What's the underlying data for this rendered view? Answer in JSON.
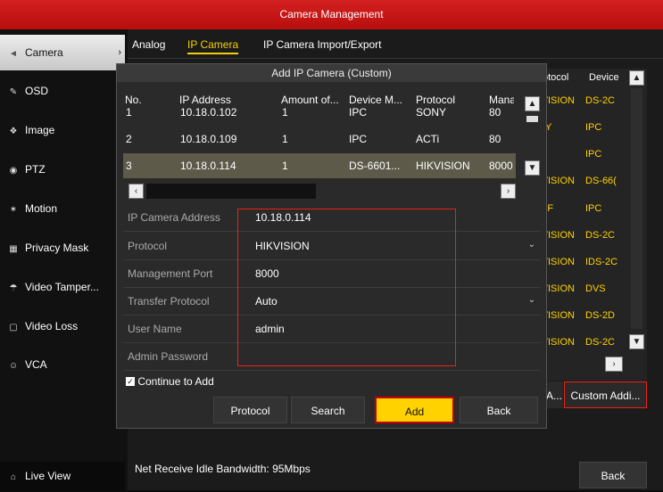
{
  "titlebar": {
    "title": "Camera Management"
  },
  "sidebar": {
    "items": [
      {
        "label": "Camera",
        "icon": "camera-icon",
        "glyph": "◄"
      },
      {
        "label": "OSD",
        "icon": "osd-icon",
        "glyph": "✎"
      },
      {
        "label": "Image",
        "icon": "image-icon",
        "glyph": "❖"
      },
      {
        "label": "PTZ",
        "icon": "ptz-icon",
        "glyph": "◉"
      },
      {
        "label": "Motion",
        "icon": "motion-icon",
        "glyph": "✶"
      },
      {
        "label": "Privacy Mask",
        "icon": "privacy-mask-icon",
        "glyph": "▦"
      },
      {
        "label": "Video Tamper...",
        "icon": "video-tamper-icon",
        "glyph": "☂"
      },
      {
        "label": "Video Loss",
        "icon": "video-loss-icon",
        "glyph": "▢"
      },
      {
        "label": "VCA",
        "icon": "vca-icon",
        "glyph": "☺"
      }
    ],
    "live_view": "Live View"
  },
  "tabs": [
    "Analog",
    "IP Camera",
    "IP Camera Import/Export"
  ],
  "bg_table": {
    "headers": [
      "otocol",
      "Device"
    ],
    "rows": [
      [
        "(VISION",
        "DS-2C"
      ],
      [
        "NY",
        "IPC"
      ],
      [
        "TI",
        "IPC"
      ],
      [
        "(VISION",
        "DS-66("
      ],
      [
        "VIF",
        "IPC"
      ],
      [
        "(VISION",
        "DS-2C"
      ],
      [
        "(VISION",
        "IDS-2C"
      ],
      [
        "(VISION",
        "DVS"
      ],
      [
        "(VISION",
        "DS-2D"
      ],
      [
        "(VISION",
        "DS-2C"
      ]
    ]
  },
  "dialog": {
    "title": "Add IP Camera (Custom)",
    "headers": [
      "No.",
      "IP Address",
      "Amount of...",
      "Device M...",
      "Protocol",
      "Mana"
    ],
    "rows": [
      [
        "1",
        "10.18.0.102",
        "1",
        "IPC",
        "SONY",
        "80"
      ],
      [
        "2",
        "10.18.0.109",
        "1",
        "IPC",
        "ACTi",
        "80"
      ],
      [
        "3",
        "10.18.0.114",
        "1",
        "DS-6601...",
        "HIKVISION",
        "8000"
      ]
    ],
    "form": [
      {
        "label": "IP Camera Address",
        "value": "10.18.0.114",
        "dropdown": ""
      },
      {
        "label": "Protocol",
        "value": "HIKVISION",
        "dropdown": "⌄"
      },
      {
        "label": "Management Port",
        "value": "8000",
        "dropdown": ""
      },
      {
        "label": "Transfer Protocol",
        "value": "Auto",
        "dropdown": "⌄"
      },
      {
        "label": "User Name",
        "value": "admin",
        "dropdown": ""
      },
      {
        "label": "Admin Password",
        "value": "",
        "dropdown": ""
      }
    ],
    "continue_label": "Continue to Add",
    "buttons": {
      "protocol": "Protocol",
      "search": "Search",
      "add": "Add",
      "back": "Back"
    }
  },
  "main": {
    "bandwidth": "Net Receive Idle Bandwidth: 95Mbps",
    "custom_add": "Custom Addi...",
    "partial_btn": "A...",
    "back": "Back"
  }
}
